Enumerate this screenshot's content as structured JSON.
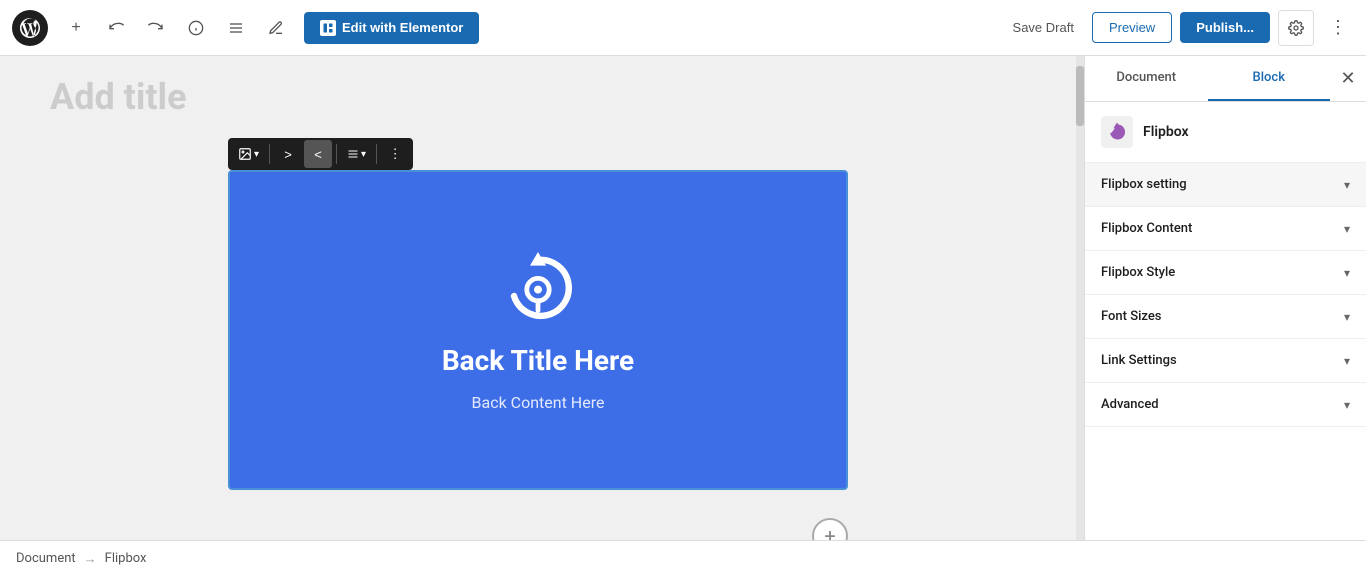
{
  "topbar": {
    "edit_elementor_label": "Edit with Elementor",
    "save_draft_label": "Save Draft",
    "preview_label": "Preview",
    "publish_label": "Publish...",
    "wp_logo_title": "WordPress"
  },
  "editor": {
    "page_title_placeholder": "Add title",
    "flipbox": {
      "back_title": "Back Title Here",
      "back_content": "Back Content Here"
    }
  },
  "breadcrumb": {
    "root": "Document",
    "separator": "→",
    "current": "Flipbox"
  },
  "right_panel": {
    "tabs": {
      "document_label": "Document",
      "block_label": "Block"
    },
    "block_name": "Flipbox",
    "sections": [
      {
        "id": "flipbox-setting",
        "label": "Flipbox setting",
        "open": true
      },
      {
        "id": "flipbox-content",
        "label": "Flipbox Content",
        "open": false
      },
      {
        "id": "flipbox-style",
        "label": "Flipbox Style",
        "open": false
      },
      {
        "id": "font-sizes",
        "label": "Font Sizes",
        "open": false
      },
      {
        "id": "link-settings",
        "label": "Link Settings",
        "open": false
      },
      {
        "id": "advanced",
        "label": "Advanced",
        "open": false
      }
    ]
  }
}
